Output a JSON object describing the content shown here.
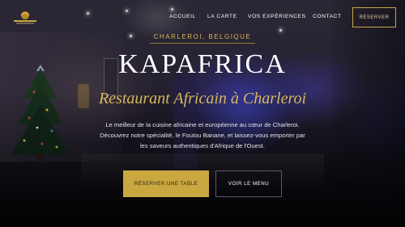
{
  "header": {
    "logo_alt": "KAPAFRICA",
    "nav": [
      {
        "label": "ACCUEIL"
      },
      {
        "label": "LA CARTE"
      },
      {
        "label": "VOS EXPÉRIENCES"
      },
      {
        "label": "CONTACT"
      }
    ],
    "reserve_label": "RÉSERVER"
  },
  "hero": {
    "city": "CHARLEROI, BELGIQUE",
    "title": "KAPAFRICA",
    "tagline": "Restaurant Africain à Charleroi",
    "description": "Le meilleur de la cuisine africaine et européenne au cœur de Charleroi. Découvrez notre spécialité, le Foutou Banane, et laissez-vous emporter par les saveurs authentiques d'Afrique de l'Ouest.",
    "primary_button": "RÉSERVER UNE TABLE",
    "secondary_button": "VOIR LE MENU"
  },
  "colors": {
    "accent": "#c9a83f",
    "accent_text": "#d6b75c",
    "background": "#0b0a10"
  },
  "icons": {
    "logo": "kapafrica-logo"
  }
}
